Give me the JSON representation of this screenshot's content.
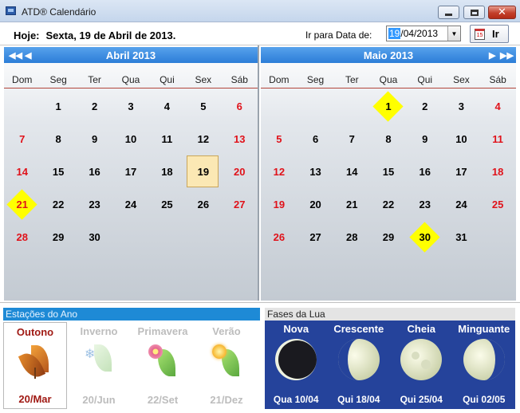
{
  "window": {
    "title": "ATD® Calendário",
    "close_glyph": "✕"
  },
  "header": {
    "today_label": "Hoje:",
    "today_value": "Sexta, 19 de Abril de 2013.",
    "goto_label": "Ir para Data de:",
    "date_day": "19",
    "date_rest": "/04/2013",
    "dropdown_glyph": "▼",
    "calendar_icon_text": "15",
    "go_label": "Ir"
  },
  "weekdays": [
    "Dom",
    "Seg",
    "Ter",
    "Qua",
    "Qui",
    "Sex",
    "Sáb"
  ],
  "calendars": [
    {
      "title": "Abril 2013",
      "nav_prev_year": "◀◀",
      "nav_prev": "◀",
      "first_weekday": 1,
      "days": 30,
      "today": 19,
      "marked": [
        21
      ]
    },
    {
      "title": "Maio 2013",
      "nav_next": "▶",
      "nav_next_year": "▶▶",
      "first_weekday": 3,
      "days": 31,
      "today": null,
      "marked": [
        1,
        30
      ]
    }
  ],
  "seasons": {
    "title": "Estações do Ano",
    "items": [
      {
        "name": "Outono",
        "date": "20/Mar",
        "active": true,
        "icon": "autumn-leaf-icon"
      },
      {
        "name": "Inverno",
        "date": "20/Jun",
        "active": false,
        "icon": "winter-leaf-icon"
      },
      {
        "name": "Primavera",
        "date": "22/Set",
        "active": false,
        "icon": "spring-flower-icon"
      },
      {
        "name": "Verão",
        "date": "21/Dez",
        "active": false,
        "icon": "summer-sun-icon"
      }
    ]
  },
  "moon_phases": {
    "title": "Fases da Lua",
    "items": [
      {
        "name": "Nova",
        "date": "Qua 10/04",
        "icon": "new-moon-icon"
      },
      {
        "name": "Crescente",
        "date": "Qui 18/04",
        "icon": "first-quarter-moon-icon"
      },
      {
        "name": "Cheia",
        "date": "Qui 25/04",
        "icon": "full-moon-icon"
      },
      {
        "name": "Minguante",
        "date": "Qui 02/05",
        "icon": "last-quarter-moon-icon"
      }
    ]
  },
  "colors": {
    "accent_blue": "#2c7dd8",
    "weekend_red": "#e0121a",
    "highlight_yellow": "#ffff00",
    "moon_panel": "#25439b"
  }
}
